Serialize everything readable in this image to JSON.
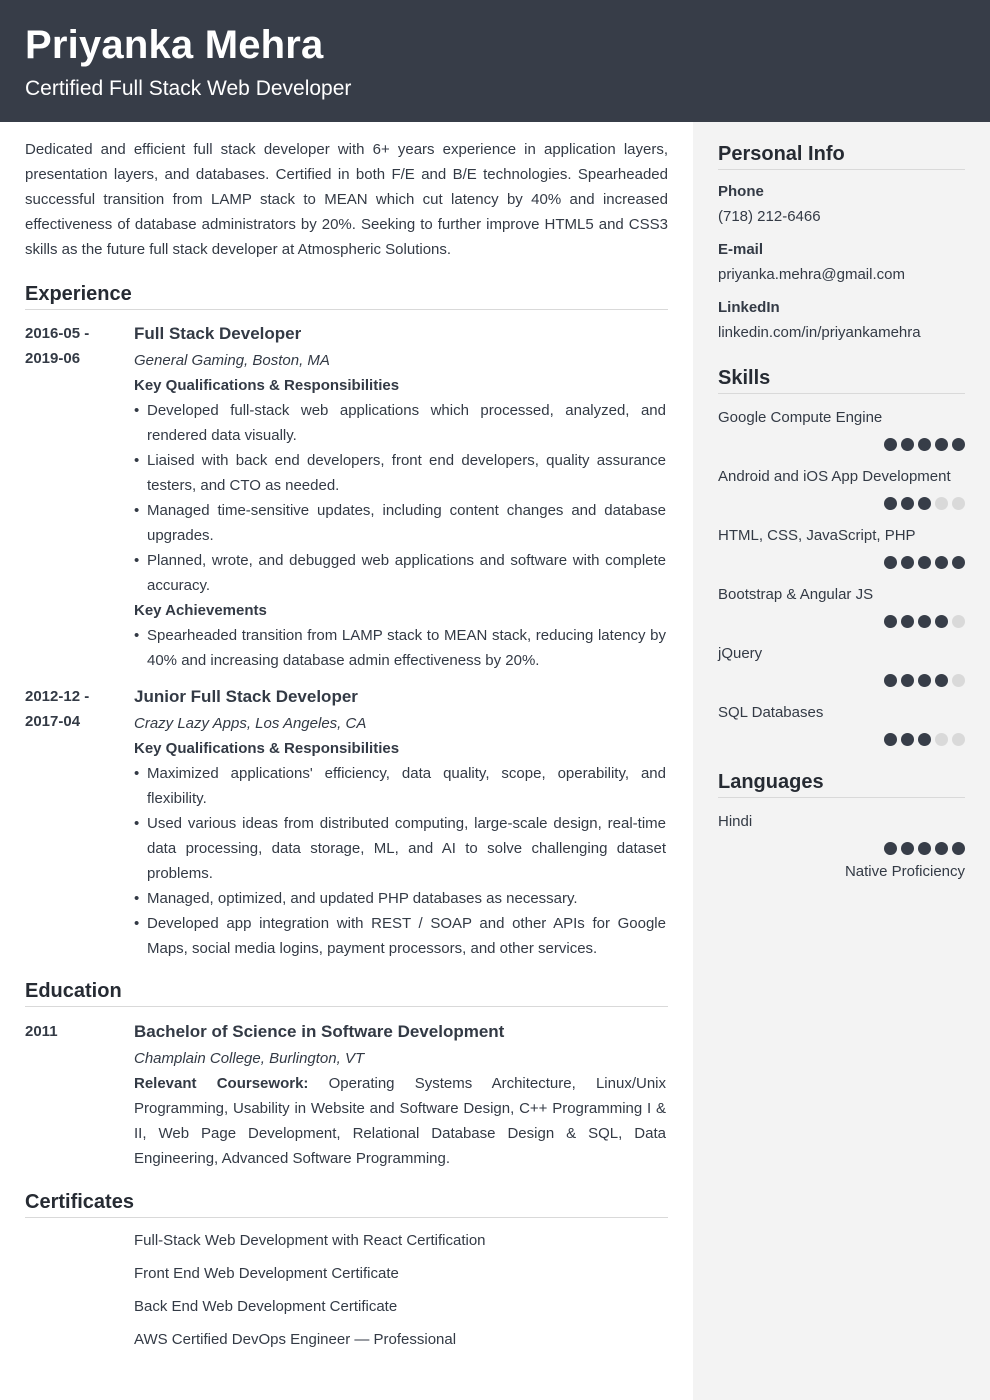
{
  "header": {
    "name": "Priyanka Mehra",
    "title": "Certified Full Stack Web Developer"
  },
  "summary": "Dedicated and efficient full stack developer with 6+ years experience in application layers, presentation layers, and databases. Certified in both F/E and B/E technologies. Spearheaded successful transition from LAMP stack to MEAN which cut latency by 40% and increased effectiveness of database administrators by 20%. Seeking to further improve HTML5 and CSS3 skills as the future full stack developer at Atmospheric Solutions.",
  "experience": {
    "title": "Experience",
    "entries": [
      {
        "date_start": "2016-05 -",
        "date_end": "2019-06",
        "role": "Full Stack Developer",
        "company": "General Gaming, Boston, MA",
        "qual_heading": "Key Qualifications & Responsibilities",
        "qualifications": [
          "Developed full-stack web applications which processed, analyzed, and rendered data visually.",
          "Liaised with back end developers, front end developers, quality assurance testers, and CTO as needed.",
          "Managed time-sensitive updates, including content changes and database upgrades.",
          "Planned, wrote, and debugged web applications and software with complete accuracy."
        ],
        "ach_heading": "Key Achievements",
        "achievements": [
          "Spearheaded transition from LAMP stack to MEAN stack, reducing latency by 40% and increasing database admin effectiveness by 20%."
        ]
      },
      {
        "date_start": "2012-12 -",
        "date_end": "2017-04",
        "role": "Junior Full Stack Developer",
        "company": "Crazy Lazy Apps, Los Angeles, CA",
        "qual_heading": "Key Qualifications & Responsibilities",
        "qualifications": [
          "Maximized applications' efficiency, data quality, scope, operability, and flexibility.",
          "Used various ideas from distributed computing, large-scale design, real-time data processing, data storage, ML, and AI to solve challenging dataset problems.",
          "Managed, optimized, and updated PHP databases as necessary.",
          "Developed app integration with REST / SOAP and other APIs for Google Maps, social media logins, payment processors, and other services."
        ]
      }
    ]
  },
  "education": {
    "title": "Education",
    "entries": [
      {
        "date": "2011",
        "degree": "Bachelor of Science in Software Development",
        "school": "Champlain College, Burlington, VT",
        "coursework_label": "Relevant Coursework:",
        "coursework": "Operating Systems Architecture, Linux/Unix Programming, Usability in Website and Software Design, C++ Programming I & II, Web Page Development, Relational Database Design & SQL, Data Engineering, Advanced Software Programming."
      }
    ]
  },
  "certificates": {
    "title": "Certificates",
    "items": [
      "Full-Stack Web Development with React Certification",
      "Front End Web Development Certificate",
      "Back End Web Development Certificate",
      "AWS Certified DevOps Engineer — Professional"
    ]
  },
  "personal_info": {
    "title": "Personal Info",
    "fields": [
      {
        "label": "Phone",
        "value": "(718) 212-6466"
      },
      {
        "label": "E-mail",
        "value": "priyanka.mehra@gmail.com"
      },
      {
        "label": "LinkedIn",
        "value": "linkedin.com/in/priyankamehra"
      }
    ]
  },
  "skills": {
    "title": "Skills",
    "max_rating": 5,
    "items": [
      {
        "name": "Google Compute Engine",
        "rating": 5
      },
      {
        "name": "Android and iOS App Development",
        "rating": 3
      },
      {
        "name": "HTML, CSS, JavaScript, PHP",
        "rating": 5
      },
      {
        "name": "Bootstrap & Angular JS",
        "rating": 4
      },
      {
        "name": "jQuery",
        "rating": 4
      },
      {
        "name": "SQL Databases",
        "rating": 3
      }
    ]
  },
  "languages": {
    "title": "Languages",
    "items": [
      {
        "name": "Hindi",
        "rating": 5,
        "level": "Native Proficiency"
      }
    ]
  },
  "colors": {
    "header_bg": "#373d48",
    "sidebar_bg": "#f3f3f3",
    "dot_filled": "#373d48",
    "dot_empty": "#d9d9d9"
  }
}
